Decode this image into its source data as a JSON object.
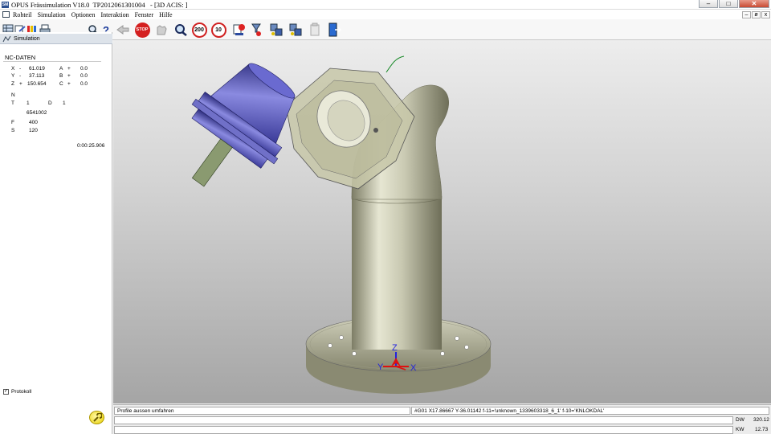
{
  "window": {
    "title": "OPUS Frässimulation V18.0  TP2012061301004   - [3D ACIS: ]",
    "controls": [
      "–",
      "□",
      "✕"
    ],
    "mdi_controls": [
      "–",
      "ø",
      "x"
    ]
  },
  "menu": {
    "items": [
      "Rohteil",
      "Simulation",
      "Optionen",
      "Interaktion",
      "Fenster",
      "Hilfe"
    ]
  },
  "toolbar": {
    "stop_label": "STOP",
    "speed_200": "200",
    "speed_10": "10",
    "help_label": "?"
  },
  "sidebar": {
    "tab_label": "Simulation",
    "nc_title": "NC-DATEN",
    "rows": [
      {
        "label": "X",
        "sign": "-",
        "value": "61.019",
        "label2": "A",
        "sign2": "+",
        "value2": "0.0"
      },
      {
        "label": "Y",
        "sign": "-",
        "value": "37.113",
        "label2": "B",
        "sign2": "+",
        "value2": "0.0"
      },
      {
        "label": "Z",
        "sign": "+",
        "value": "150.654",
        "label2": "C",
        "sign2": "+",
        "value2": "0.0"
      }
    ],
    "n_label": "N",
    "t_label": "T",
    "t_value": "1",
    "d_label": "D",
    "d_value": "1",
    "tool_number": "6541002",
    "f_label": "F",
    "f_value": "400",
    "s_label": "S",
    "s_value": "120",
    "time": "0:00:25.906",
    "protokoll_label": "Protokoll",
    "protokoll_checked": "✓"
  },
  "viewport": {
    "axis_x": "X",
    "axis_y": "Y",
    "axis_z": "Z",
    "colors": {
      "tool": "#5050b8",
      "part": "#b8b8a0",
      "axis_z": "#2222dd",
      "axis_marker": "#dd1111"
    }
  },
  "status": {
    "message": "Profile aussen umfahren",
    "nc_line": "#G01 X17.86667 Y-36.01142 f-11='unknown_1339603318_6_1' f-10='KNLOKDAL'",
    "dw_label": "DW",
    "dw_value": "320.12",
    "kw_label": "KW",
    "kw_value": "12.73"
  }
}
